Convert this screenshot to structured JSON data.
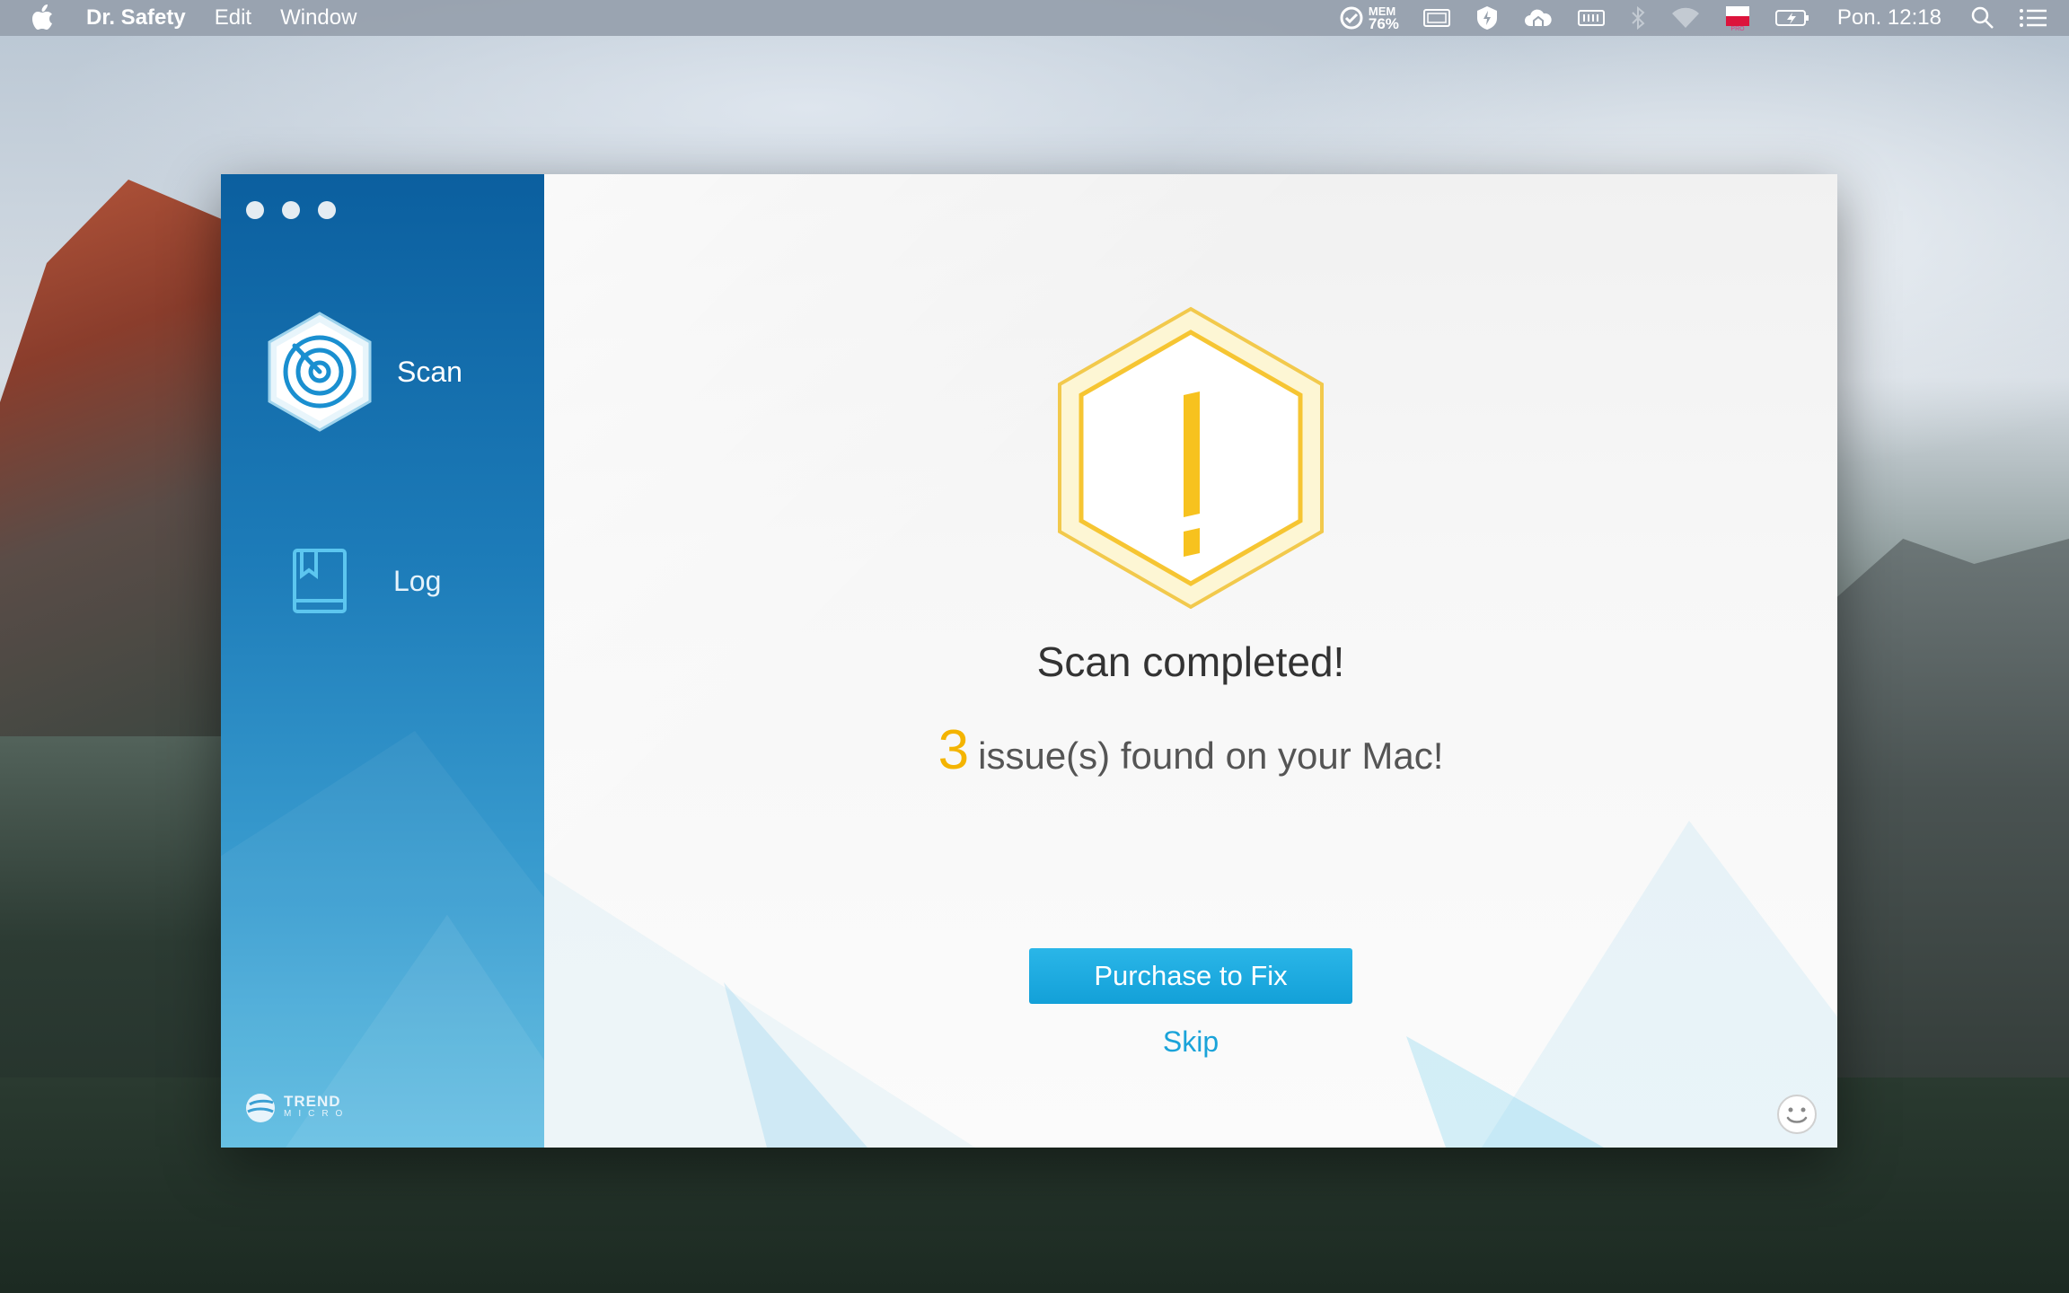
{
  "menubar": {
    "app_name": "Dr. Safety",
    "menus": [
      "Edit",
      "Window"
    ],
    "mem_label": "MEM",
    "mem_value": "76%",
    "clock": "Pon. 12:18"
  },
  "window": {
    "sidebar": {
      "items": [
        {
          "label": "Scan",
          "icon": "radar-icon"
        },
        {
          "label": "Log",
          "icon": "book-icon"
        }
      ],
      "brand_line1": "TREND",
      "brand_line2": "MICRO"
    },
    "main": {
      "title": "Scan completed!",
      "issue_count": "3",
      "issue_text": "issue(s) found on your Mac!",
      "purchase_label": "Purchase to Fix",
      "skip_label": "Skip"
    }
  },
  "colors": {
    "accent": "#13a0d8",
    "warning": "#f4b400",
    "sidebar_top": "#0b5f9f",
    "sidebar_bottom": "#5fbde2"
  }
}
